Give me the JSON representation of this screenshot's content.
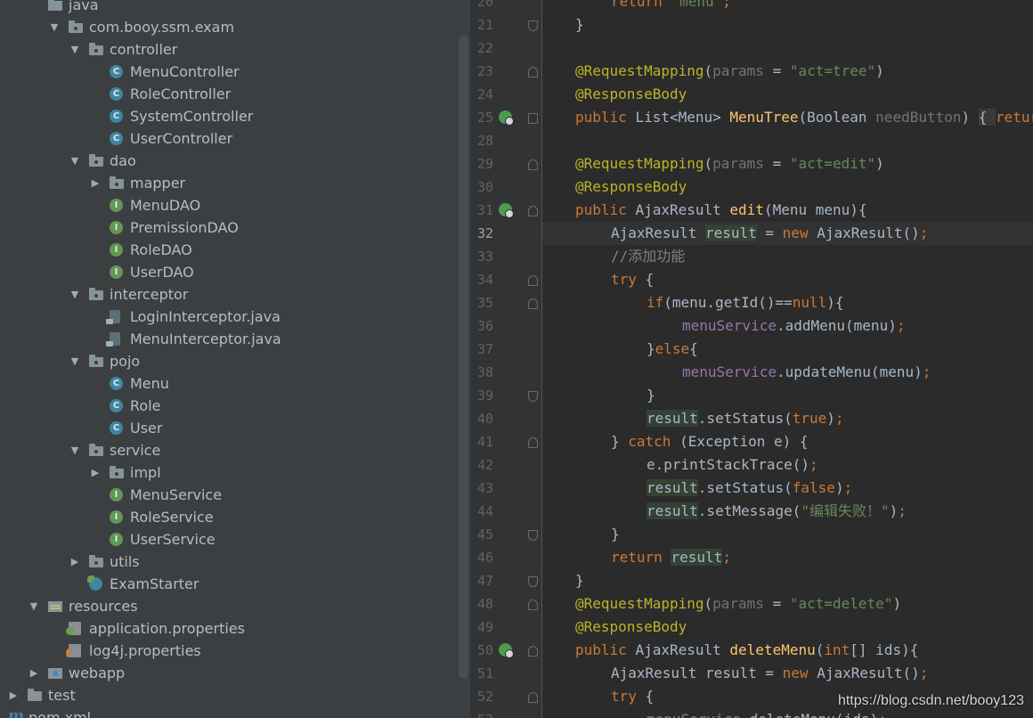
{
  "tree": [
    {
      "label": "java",
      "icon": "folder",
      "arrow": "",
      "depth": 2
    },
    {
      "label": "com.booy.ssm.exam",
      "icon": "package",
      "arrow": "down",
      "depth": 3
    },
    {
      "label": "controller",
      "icon": "package",
      "arrow": "down",
      "depth": 4
    },
    {
      "label": "MenuController",
      "icon": "class",
      "arrow": "",
      "depth": 5
    },
    {
      "label": "RoleController",
      "icon": "class",
      "arrow": "",
      "depth": 5
    },
    {
      "label": "SystemController",
      "icon": "class",
      "arrow": "",
      "depth": 5
    },
    {
      "label": "UserController",
      "icon": "class",
      "arrow": "",
      "depth": 5
    },
    {
      "label": "dao",
      "icon": "package",
      "arrow": "down",
      "depth": 4
    },
    {
      "label": "mapper",
      "icon": "package",
      "arrow": "right",
      "depth": 5
    },
    {
      "label": "MenuDAO",
      "icon": "interface",
      "arrow": "",
      "depth": 5
    },
    {
      "label": "PremissionDAO",
      "icon": "interface",
      "arrow": "",
      "depth": 5
    },
    {
      "label": "RoleDAO",
      "icon": "interface",
      "arrow": "",
      "depth": 5
    },
    {
      "label": "UserDAO",
      "icon": "interface",
      "arrow": "",
      "depth": 5
    },
    {
      "label": "interceptor",
      "icon": "package",
      "arrow": "down",
      "depth": 4
    },
    {
      "label": "LoginInterceptor.java",
      "icon": "java-file",
      "arrow": "",
      "depth": 5
    },
    {
      "label": "MenuInterceptor.java",
      "icon": "java-file",
      "arrow": "",
      "depth": 5
    },
    {
      "label": "pojo",
      "icon": "package",
      "arrow": "down",
      "depth": 4
    },
    {
      "label": "Menu",
      "icon": "class",
      "arrow": "",
      "depth": 5
    },
    {
      "label": "Role",
      "icon": "class",
      "arrow": "",
      "depth": 5
    },
    {
      "label": "User",
      "icon": "class",
      "arrow": "",
      "depth": 5
    },
    {
      "label": "service",
      "icon": "package",
      "arrow": "down",
      "depth": 4
    },
    {
      "label": "impl",
      "icon": "package",
      "arrow": "right",
      "depth": 5
    },
    {
      "label": "MenuService",
      "icon": "interface",
      "arrow": "",
      "depth": 5
    },
    {
      "label": "RoleService",
      "icon": "interface",
      "arrow": "",
      "depth": 5
    },
    {
      "label": "UserService",
      "icon": "interface",
      "arrow": "",
      "depth": 5
    },
    {
      "label": "utils",
      "icon": "package",
      "arrow": "right",
      "depth": 4
    },
    {
      "label": "ExamStarter",
      "icon": "spring-class",
      "arrow": "",
      "depth": 4
    },
    {
      "label": "resources",
      "icon": "resources-folder",
      "arrow": "down",
      "depth": 2
    },
    {
      "label": "application.properties",
      "icon": "spring-properties",
      "arrow": "",
      "depth": 3
    },
    {
      "label": "log4j.properties",
      "icon": "log-properties",
      "arrow": "",
      "depth": 3
    },
    {
      "label": "webapp",
      "icon": "web-folder",
      "arrow": "right",
      "depth": 2
    },
    {
      "label": "test",
      "icon": "folder",
      "arrow": "right",
      "depth": 1
    },
    {
      "label": "pom.xml",
      "icon": "maven-file",
      "arrow": "",
      "depth": 1
    }
  ],
  "editor": {
    "current_line": "32",
    "lines": [
      {
        "n": "20",
        "fold": "",
        "bean": false,
        "indent": 2,
        "seg": [
          [
            "kw",
            "return "
          ],
          [
            "str",
            "\"menu\""
          ],
          [
            "kw",
            ";"
          ]
        ]
      },
      {
        "n": "21",
        "fold": "up",
        "bean": false,
        "indent": 1,
        "seg": [
          [
            "",
            "}"
          ]
        ]
      },
      {
        "n": "22",
        "fold": "",
        "bean": false,
        "indent": 0,
        "seg": []
      },
      {
        "n": "23",
        "fold": "down",
        "bean": false,
        "indent": 1,
        "seg": [
          [
            "an",
            "@RequestMapping"
          ],
          [
            "",
            "("
          ],
          [
            "par",
            "params"
          ],
          [
            "",
            " = "
          ],
          [
            "str",
            "\"act=tree\""
          ],
          [
            "",
            ")"
          ]
        ]
      },
      {
        "n": "24",
        "fold": "",
        "bean": false,
        "indent": 1,
        "seg": [
          [
            "an",
            "@ResponseBody"
          ]
        ]
      },
      {
        "n": "25",
        "fold": "box",
        "bean": true,
        "indent": 1,
        "seg": [
          [
            "kw",
            "public "
          ],
          [
            "",
            "List<Menu> "
          ],
          [
            "fn",
            "MenuTree"
          ],
          [
            "",
            "(Boolean "
          ],
          [
            "par",
            "needButton"
          ],
          [
            "",
            ") "
          ],
          [
            "fbox",
            "{ "
          ],
          [
            "kw",
            "return"
          ]
        ]
      },
      {
        "n": "28",
        "fold": "",
        "bean": false,
        "indent": 0,
        "seg": []
      },
      {
        "n": "29",
        "fold": "down",
        "bean": false,
        "indent": 1,
        "seg": [
          [
            "an",
            "@RequestMapping"
          ],
          [
            "",
            "("
          ],
          [
            "par",
            "params"
          ],
          [
            "",
            " = "
          ],
          [
            "str",
            "\"act=edit\""
          ],
          [
            "",
            ")"
          ]
        ]
      },
      {
        "n": "30",
        "fold": "",
        "bean": false,
        "indent": 1,
        "seg": [
          [
            "an",
            "@ResponseBody"
          ]
        ]
      },
      {
        "n": "31",
        "fold": "down",
        "bean": true,
        "indent": 1,
        "seg": [
          [
            "kw",
            "public "
          ],
          [
            "",
            "AjaxResult "
          ],
          [
            "fn",
            "edit"
          ],
          [
            "",
            "(Menu menu){"
          ]
        ]
      },
      {
        "n": "32",
        "fold": "",
        "bean": false,
        "indent": 2,
        "seg": [
          [
            "",
            "AjaxResult "
          ],
          [
            "hl",
            "result"
          ],
          [
            "",
            " = "
          ],
          [
            "kw",
            "new "
          ],
          [
            "",
            "AjaxResult()"
          ],
          [
            "kw",
            ";"
          ]
        ]
      },
      {
        "n": "33",
        "fold": "",
        "bean": false,
        "indent": 2,
        "seg": [
          [
            "cm",
            "//添加功能"
          ]
        ]
      },
      {
        "n": "34",
        "fold": "down",
        "bean": false,
        "indent": 2,
        "seg": [
          [
            "kw",
            "try "
          ],
          [
            "",
            "{"
          ]
        ]
      },
      {
        "n": "35",
        "fold": "down",
        "bean": false,
        "indent": 3,
        "seg": [
          [
            "kw",
            "if"
          ],
          [
            "",
            "(menu.getId()=="
          ],
          [
            "kw",
            "null"
          ],
          [
            "",
            "){"
          ]
        ]
      },
      {
        "n": "36",
        "fold": "",
        "bean": false,
        "indent": 4,
        "seg": [
          [
            "fld",
            "menuService"
          ],
          [
            "",
            ".addMenu(menu)"
          ],
          [
            "kw",
            ";"
          ]
        ]
      },
      {
        "n": "37",
        "fold": "",
        "bean": false,
        "indent": 3,
        "seg": [
          [
            "",
            "}"
          ],
          [
            "kw",
            "else"
          ],
          [
            "",
            "{"
          ]
        ]
      },
      {
        "n": "38",
        "fold": "",
        "bean": false,
        "indent": 4,
        "seg": [
          [
            "fld",
            "menuService"
          ],
          [
            "",
            ".updateMenu(menu)"
          ],
          [
            "kw",
            ";"
          ]
        ]
      },
      {
        "n": "39",
        "fold": "up",
        "bean": false,
        "indent": 3,
        "seg": [
          [
            "",
            "}"
          ]
        ]
      },
      {
        "n": "40",
        "fold": "",
        "bean": false,
        "indent": 3,
        "seg": [
          [
            "hl",
            "result"
          ],
          [
            "",
            ".setStatus("
          ],
          [
            "kw",
            "true"
          ],
          [
            "",
            ")"
          ],
          [
            "kw",
            ";"
          ]
        ]
      },
      {
        "n": "41",
        "fold": "down",
        "bean": false,
        "indent": 2,
        "seg": [
          [
            "",
            "} "
          ],
          [
            "kw",
            "catch "
          ],
          [
            "",
            "(Exception e) {"
          ]
        ]
      },
      {
        "n": "42",
        "fold": "",
        "bean": false,
        "indent": 3,
        "seg": [
          [
            "",
            "e.printStackTrace()"
          ],
          [
            "kw",
            ";"
          ]
        ]
      },
      {
        "n": "43",
        "fold": "",
        "bean": false,
        "indent": 3,
        "seg": [
          [
            "hl",
            "result"
          ],
          [
            "",
            ".setStatus("
          ],
          [
            "kw",
            "false"
          ],
          [
            "",
            ")"
          ],
          [
            "kw",
            ";"
          ]
        ]
      },
      {
        "n": "44",
        "fold": "",
        "bean": false,
        "indent": 3,
        "seg": [
          [
            "hl",
            "result"
          ],
          [
            "",
            ".setMessage("
          ],
          [
            "str",
            "\"编辑失败！\""
          ],
          [
            "",
            ")"
          ],
          [
            "kw",
            ";"
          ]
        ]
      },
      {
        "n": "45",
        "fold": "up",
        "bean": false,
        "indent": 2,
        "seg": [
          [
            "",
            "}"
          ]
        ]
      },
      {
        "n": "46",
        "fold": "",
        "bean": false,
        "indent": 2,
        "seg": [
          [
            "kw",
            "return "
          ],
          [
            "hl",
            "result"
          ],
          [
            "kw",
            ";"
          ]
        ]
      },
      {
        "n": "47",
        "fold": "up",
        "bean": false,
        "indent": 1,
        "seg": [
          [
            "",
            "}"
          ]
        ]
      },
      {
        "n": "48",
        "fold": "down",
        "bean": false,
        "indent": 1,
        "seg": [
          [
            "an",
            "@RequestMapping"
          ],
          [
            "",
            "("
          ],
          [
            "par",
            "params"
          ],
          [
            "",
            " = "
          ],
          [
            "str",
            "\"act=delete\""
          ],
          [
            "",
            ")"
          ]
        ]
      },
      {
        "n": "49",
        "fold": "",
        "bean": false,
        "indent": 1,
        "seg": [
          [
            "an",
            "@ResponseBody"
          ]
        ]
      },
      {
        "n": "50",
        "fold": "down",
        "bean": true,
        "indent": 1,
        "seg": [
          [
            "kw",
            "public "
          ],
          [
            "",
            "AjaxResult "
          ],
          [
            "fn",
            "deleteMenu"
          ],
          [
            "",
            "("
          ],
          [
            "kw",
            "int"
          ],
          [
            "",
            "[] ids){"
          ]
        ]
      },
      {
        "n": "51",
        "fold": "",
        "bean": false,
        "indent": 2,
        "seg": [
          [
            "",
            "AjaxResult result = "
          ],
          [
            "kw",
            "new "
          ],
          [
            "",
            "AjaxResult()"
          ],
          [
            "kw",
            ";"
          ]
        ]
      },
      {
        "n": "52",
        "fold": "down",
        "bean": false,
        "indent": 2,
        "seg": [
          [
            "kw",
            "try "
          ],
          [
            "",
            "{"
          ]
        ]
      },
      {
        "n": "53",
        "fold": "",
        "bean": false,
        "indent": 3,
        "seg": [
          [
            "fld",
            "menuService"
          ],
          [
            "",
            ".deleteMenu(ids)"
          ],
          [
            "kw",
            ";"
          ]
        ]
      }
    ]
  },
  "watermark": "https://blog.csdn.net/booy123"
}
